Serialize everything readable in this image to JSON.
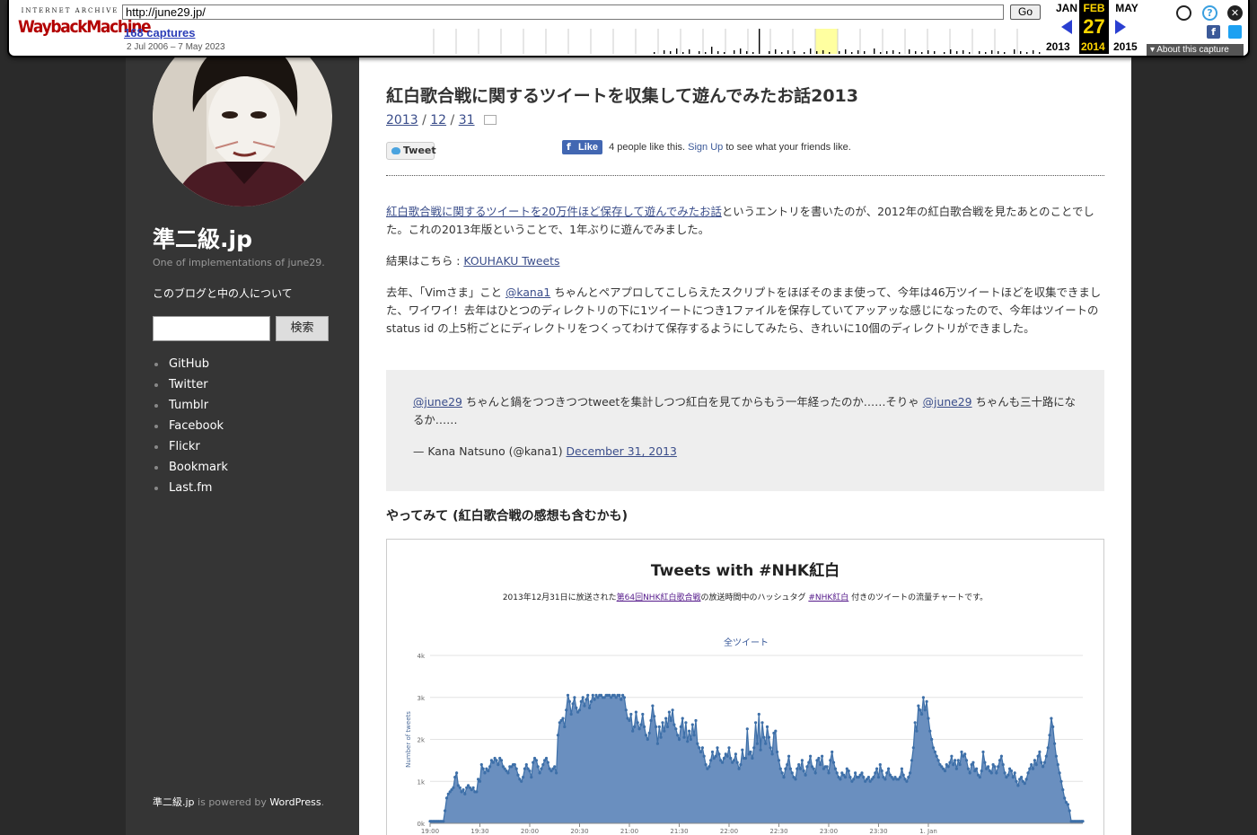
{
  "wayback": {
    "ia_label": "INTERNET ARCHIVE",
    "logo_text": "WaybackMachine",
    "url": "http://june29.jp/",
    "go_label": "Go",
    "captures": "168 captures",
    "range": "2 Jul 2006 – 7 May 2023",
    "prev_month": "JAN",
    "cur_month": "FEB",
    "next_month": "MAY",
    "cur_day": "27",
    "prev_year": "2013",
    "cur_year": "2014",
    "next_year": "2015",
    "about": "About this capture"
  },
  "sidebar": {
    "site_title": "準二級.jp",
    "tagline": "One of implementations of june29.",
    "about_link": "このブログと中の人について",
    "search_button": "検索",
    "links": [
      "GitHub",
      "Twitter",
      "Tumblr",
      "Facebook",
      "Flickr",
      "Bookmark",
      "Last.fm"
    ],
    "footer_site": "準二級.jp",
    "footer_mid": " is powered by ",
    "footer_wp": "WordPress",
    "footer_end": "."
  },
  "post": {
    "title": "紅白歌合戦に関するツイートを収集して遊んでみたお話2013",
    "date_year": "2013",
    "date_month": "12",
    "date_day": "31",
    "tweet_button": "Tweet",
    "like_button": "Like",
    "like_text": "4 people like this.",
    "like_signup": "Sign Up",
    "like_rest": "to see what your friends like.",
    "p1_link": "紅白歌合戦に関するツイートを20万件ほど保存して遊んでみたお話",
    "p1_rest": "というエントリを書いたのが、2012年の紅白歌合戦を見たあとのことでした。これの2013年版ということで、1年ぶりに遊んでみました。",
    "p2_text": "結果はこちら : ",
    "p2_link": "KOUHAKU Tweets",
    "p3_a": "去年、「Vimさま」こと ",
    "p3_link": "@kana1",
    "p3_b": " ちゃんとペアプロしてこしらえたスクリプトをほぼそのまま使って、今年は46万ツイートほどを収集できました、ワイワイ！去年はひとつのディレクトリの下に1ツイートにつき1ファイルを保存していてアッアッな感じになったので、今年はツイートの status id の上5桁ごとにディレクトリをつくってわけて保存するようにしてみたら、きれいに10個のディレクトリができました。",
    "quote_m1": "@june29",
    "quote_a": " ちゃんと鍋をつつきつつtweetを集計しつつ紅白を見てからもう一年経ったのか……そりゃ ",
    "quote_m2": "@june29",
    "quote_b": " ちゃんも三十路になるか……",
    "quote_attr": "— Kana Natsuno (@kana1) ",
    "quote_date": "December 31, 2013",
    "h3": "やってみて (紅白歌合戦の感想も含むかも)"
  },
  "chart_data": {
    "type": "area",
    "title": "Tweets with #NHK紅白",
    "subtitle_a": "2013年12月31日に放送された",
    "subtitle_link1": "第64回NHK紅白歌合戦",
    "subtitle_b": "の放送時間中のハッシュタグ ",
    "subtitle_link2": "#NHK紅白",
    "subtitle_c": " 付きのツイートの流量チャートです。",
    "series_name": "全ツイート",
    "ylabel": "Number of tweets",
    "ylim": [
      0,
      4000
    ],
    "yticks": [
      "0k",
      "1k",
      "2k",
      "3k",
      "4k"
    ],
    "xticks": [
      "19:00",
      "19:30",
      "20:00",
      "20:30",
      "21:00",
      "21:30",
      "22:00",
      "22:30",
      "23:00",
      "23:30",
      "1. Jan"
    ],
    "x_start": "19:00",
    "x_step_minutes": 1,
    "color": "#6a8fbf",
    "values": [
      50,
      50,
      50,
      50,
      50,
      50,
      50,
      50,
      50,
      300,
      600,
      700,
      750,
      800,
      850,
      1100,
      1200,
      900,
      850,
      750,
      800,
      700,
      850,
      900,
      850,
      800,
      850,
      750,
      750,
      1050,
      1000,
      1400,
      1300,
      1200,
      1300,
      1250,
      1350,
      1500,
      1450,
      1550,
      1500,
      1400,
      1550,
      1500,
      1350,
      1300,
      1250,
      1200,
      1350,
      1350,
      1400,
      1400,
      1300,
      1150,
      1050,
      1000,
      1100,
      1300,
      1400,
      1300,
      1250,
      1100,
      1450,
      1550,
      1500,
      1350,
      1200,
      1300,
      1400,
      1500,
      1550,
      1450,
      1300,
      1250,
      1300,
      1350,
      1200,
      2100,
      2400,
      2450,
      2500,
      2300,
      2700,
      3050,
      2900,
      2600,
      2850,
      3000,
      2750,
      2650,
      2700,
      2900,
      3000,
      2800,
      2950,
      3050,
      2750,
      2900,
      3050,
      2950,
      3050,
      3000,
      3050,
      3050,
      3000,
      3000,
      3050,
      3050,
      3050,
      3000,
      3050,
      3050,
      3000,
      3050,
      3050,
      2950,
      3050,
      3000,
      2700,
      2500,
      2450,
      2600,
      2200,
      2300,
      2650,
      2400,
      2250,
      2350,
      2600,
      2300,
      2100,
      2000,
      2150,
      2450,
      2800,
      2550,
      2300,
      1900,
      2300,
      2050,
      2400,
      2200,
      2500,
      2300,
      2650,
      2450,
      2700,
      2350,
      2250,
      2100,
      2000,
      2300,
      2500,
      2050,
      2400,
      1950,
      2200,
      2000,
      2350,
      2100,
      2450,
      1900,
      1800,
      1700,
      1800,
      1600,
      1400,
      1300,
      1350,
      1500,
      1700,
      1550,
      1600,
      1800,
      1650,
      1500,
      1450,
      1550,
      1650,
      1600,
      1800,
      1550,
      1450,
      1500,
      1650,
      1450,
      1300,
      1400,
      1750,
      1550,
      1550,
      2250,
      1650,
      1700,
      1550,
      1800,
      2400,
      1900,
      2600,
      1750,
      2400,
      2050,
      1900,
      2300,
      2050,
      1800,
      1650,
      2150,
      2200,
      1700,
      1500,
      1300,
      1200,
      1100,
      1300,
      1400,
      1600,
      1300,
      1200,
      1100,
      1050,
      1300,
      1400,
      1300,
      1500,
      1250,
      1150,
      1350,
      1450,
      1600,
      1350,
      1300,
      1200,
      1500,
      1550,
      1400,
      1600,
      1300,
      1350,
      1350,
      1200,
      1500,
      1700,
      1450,
      1300,
      1200,
      1100,
      1050,
      1200,
      1150,
      1100,
      1300,
      1250,
      1100,
      1000,
      1050,
      1200,
      1100,
      1100,
      1150,
      1200,
      1100,
      1000,
      1050,
      1100,
      1000,
      1050,
      1100,
      1200,
      1300,
      1100,
      1400,
      1250,
      1100,
      1050,
      1200,
      1300,
      1150,
      1100,
      1050,
      1100,
      1050,
      1050,
      1100,
      1300,
      1150,
      1050,
      1000,
      1100,
      1200,
      1500,
      1800,
      2400,
      2200,
      2800,
      2700,
      2600,
      3000,
      2700,
      2900,
      2500,
      2200,
      2000,
      1800,
      1700,
      1600,
      1500,
      1400,
      1350,
      1300,
      1250,
      1400,
      1350,
      1450,
      1600,
      1400,
      1500,
      1300,
      1500,
      1400,
      1700,
      1600,
      1650,
      1500,
      1300,
      1200,
      1400,
      1450,
      1250,
      1300,
      1150,
      1100,
      1250,
      1700,
      1450,
      1300,
      1350,
      1250,
      1200,
      1400,
      1350,
      1200,
      1350,
      1500,
      1600,
      1400,
      1200,
      1100,
      1150,
      1300,
      1250,
      1100,
      1200,
      1000,
      900,
      1050,
      1100,
      1000,
      950,
      1050,
      1200,
      1300,
      1400,
      1300,
      1500,
      1400,
      1600,
      1700,
      1450,
      1350,
      1450,
      1600,
      1800,
      2100,
      2500,
      2300,
      1900,
      1600,
      1400,
      1200,
      1000,
      800,
      600,
      500,
      450,
      300,
      50,
      50,
      50,
      50,
      50,
      50,
      50,
      50
    ]
  }
}
